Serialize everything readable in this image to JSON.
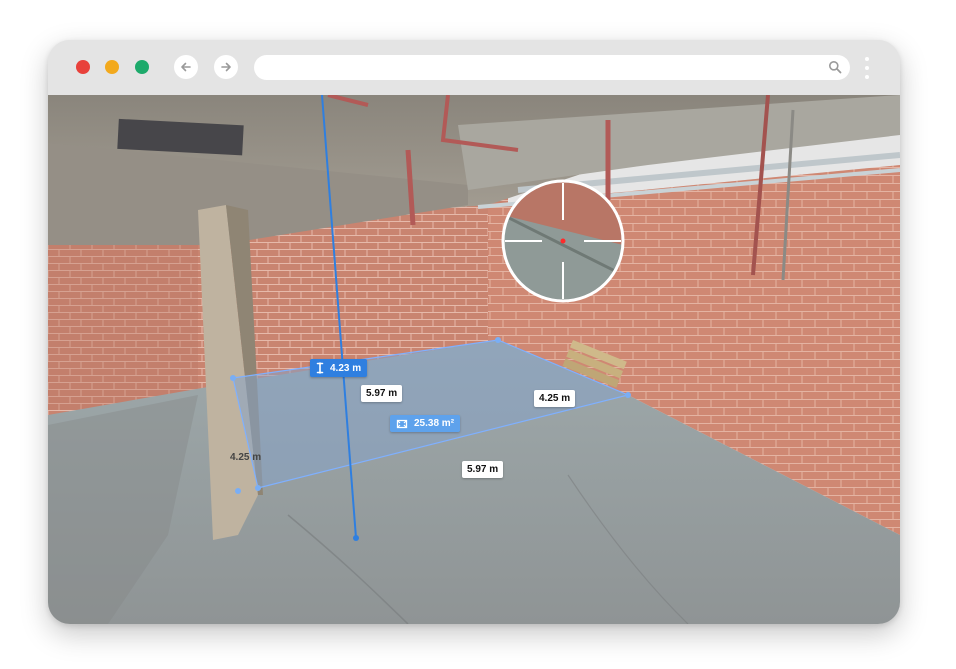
{
  "browser": {
    "url": "",
    "controls": [
      "close",
      "minimize",
      "maximize"
    ],
    "icons": [
      "back-arrow-icon",
      "forward-arrow-icon",
      "search-icon",
      "more-vertical-icon"
    ]
  },
  "measurements": {
    "height_label": "4.23 m",
    "back_width_label": "5.97 m",
    "front_width_label": "5.97 m",
    "right_depth_label": "4.25 m",
    "left_depth_label": "4.25 m",
    "area_label": "25.38 m²"
  },
  "colors": {
    "accent": "#2f7fe0",
    "area_badge": "#5ea2ec",
    "reticle_dot": "#ff2a2a",
    "wall_brick": "#c8826f",
    "floor_concrete": "#9aa3a3"
  }
}
